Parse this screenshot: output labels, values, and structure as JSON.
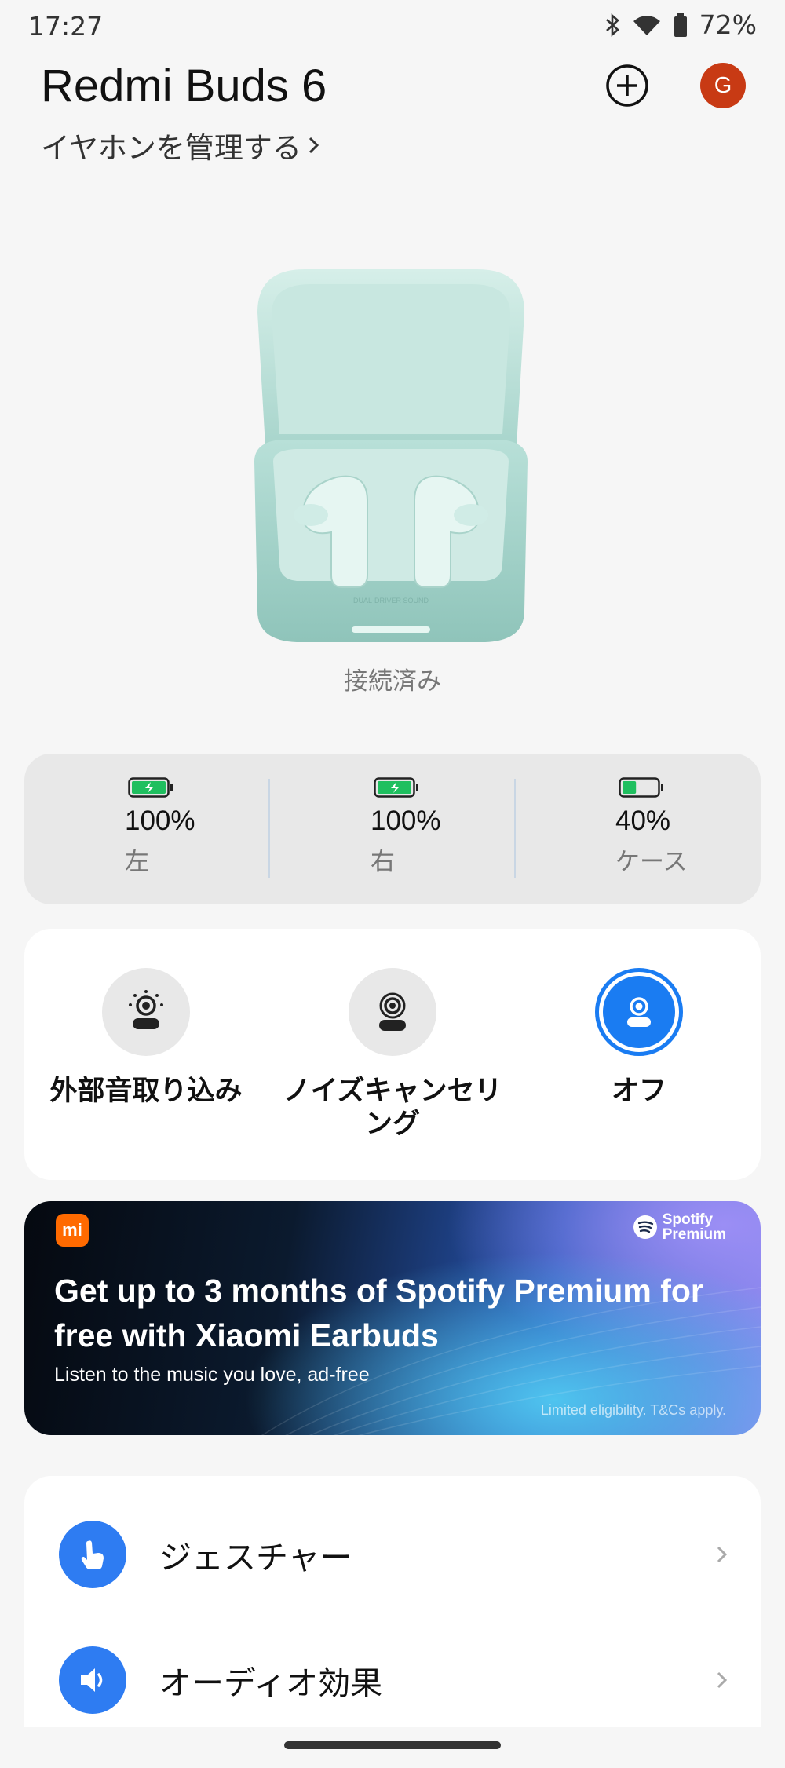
{
  "status_bar": {
    "time": "17:27",
    "battery_percent": "72%",
    "icons": [
      "bluetooth-icon",
      "wifi-icon",
      "battery-icon"
    ]
  },
  "header": {
    "title": "Redmi Buds 6",
    "manage_link": "イヤホンを管理する",
    "avatar_letter": "G",
    "avatar_color": "#c83a14"
  },
  "device": {
    "connection_status": "接続済み",
    "case_color": "#a9d8cf"
  },
  "battery": {
    "items": [
      {
        "percent": "100%",
        "label": "左",
        "level": 1.0,
        "charging": true
      },
      {
        "percent": "100%",
        "label": "右",
        "level": 1.0,
        "charging": true
      },
      {
        "percent": "40%",
        "label": "ケース",
        "level": 0.4,
        "charging": false
      }
    ],
    "fill_color": "#1fbf5f"
  },
  "noise_modes": {
    "items": [
      {
        "label": "外部音取り込み",
        "icon": "transparency-icon",
        "active": false
      },
      {
        "label": "ノイズキャンセリング",
        "icon": "noise-cancel-icon",
        "active": false
      },
      {
        "label": "オフ",
        "icon": "mode-off-icon",
        "active": true
      }
    ],
    "active_color": "#1a7cf2"
  },
  "promo": {
    "brand_badge": "mi",
    "partner_name": "Spotify",
    "partner_tier": "Premium",
    "headline": "Get up to 3 months of Spotify Premium for free with Xiaomi Earbuds",
    "subtext": "Listen to the music you love, ad-free",
    "fine_print": "Limited eligibility. T&Cs apply."
  },
  "settings": {
    "items": [
      {
        "label": "ジェスチャー",
        "icon": "gesture-hand-icon"
      },
      {
        "label": "オーディオ効果",
        "icon": "speaker-icon"
      }
    ],
    "icon_color": "#2e7cf2"
  }
}
